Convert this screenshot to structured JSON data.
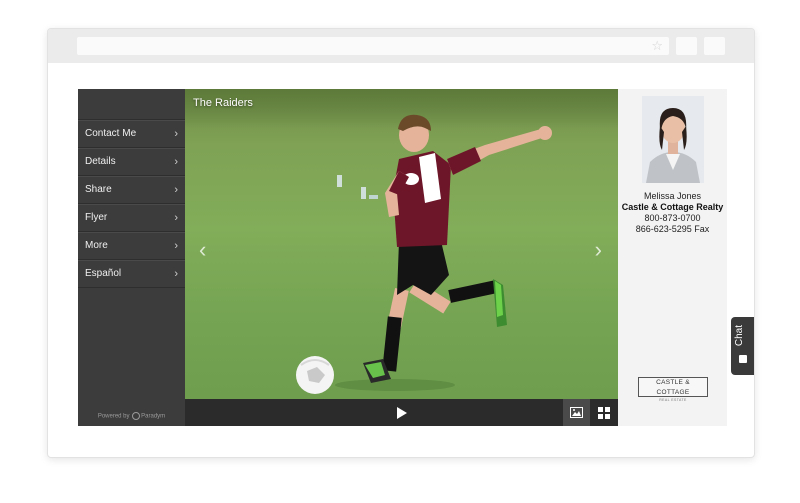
{
  "sidebar": {
    "items": [
      {
        "label": "Contact Me"
      },
      {
        "label": "Details"
      },
      {
        "label": "Share"
      },
      {
        "label": "Flyer"
      },
      {
        "label": "More"
      },
      {
        "label": "Español"
      }
    ],
    "powered_by": "Powered by",
    "powered_brand": "Paradym"
  },
  "slideshow": {
    "title": "The Raiders",
    "prev_icon": "chevron-left-icon",
    "next_icon": "chevron-right-icon"
  },
  "controls": {
    "play_icon": "play-icon",
    "photo_view_icon": "image-icon",
    "grid_view_icon": "grid-icon"
  },
  "agent": {
    "name": "Melissa Jones",
    "company": "Castle & Cottage Realty",
    "phone": "800-873-0700",
    "fax": "866-623-5295 Fax",
    "logo_main": "CASTLE & COTTAGE",
    "logo_sub": "REAL ESTATE"
  },
  "chat": {
    "label": "Chat"
  },
  "colors": {
    "sidebar_bg": "#3c3c3c",
    "control_bar_bg": "#2b2b2b",
    "panel_bg": "#f3f3f3"
  }
}
